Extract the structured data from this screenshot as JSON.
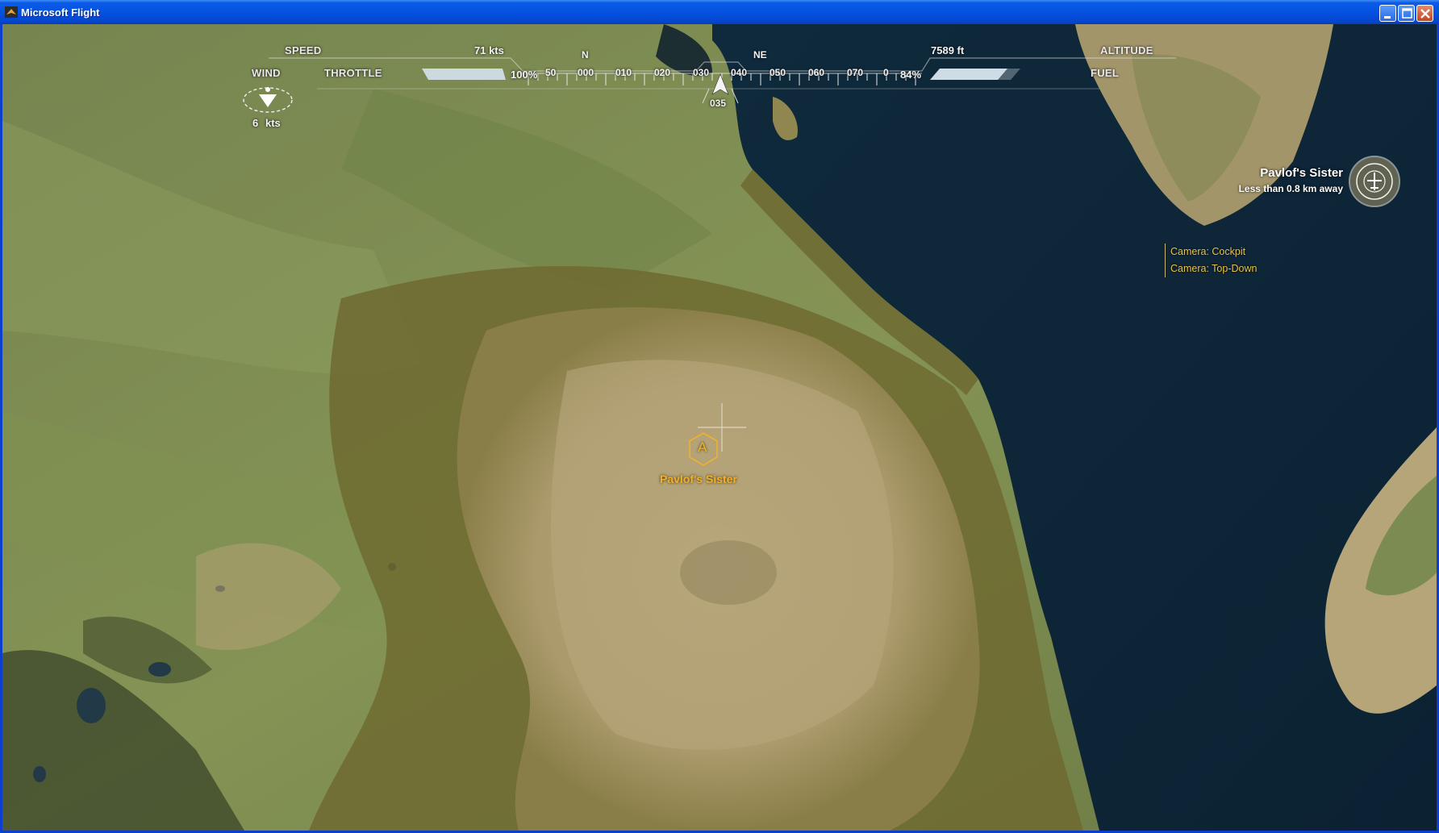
{
  "window": {
    "title": "Microsoft Flight",
    "icon": "airplane-app-icon",
    "buttons": [
      "minimize-icon",
      "maximize-icon",
      "close-icon"
    ]
  },
  "hud": {
    "speed_label": "SPEED",
    "speed_value": "71 kts",
    "wind_label": "WIND",
    "wind_value": "6",
    "wind_unit": "kts",
    "throttle_label": "THROTTLE",
    "throttle_value": "100%",
    "throttle_fraction": 1.0,
    "altitude_label": "ALTITUDE",
    "altitude_value": "7589 ft",
    "fuel_label": "FUEL",
    "fuel_value": "84%",
    "fuel_fraction": 0.84,
    "compass": {
      "cardinals": [
        "N",
        "NE"
      ],
      "ticks": [
        "50",
        "000",
        "010",
        "020",
        "030",
        "040",
        "050",
        "060",
        "070",
        "0"
      ],
      "heading": "035"
    }
  },
  "waypoint": {
    "marker_letter": "A",
    "name": "Pavlof's Sister"
  },
  "target": {
    "name": "Pavlof's Sister",
    "distance": "Less than 0.8 km away",
    "icon": "airplane-target-icon"
  },
  "camera_menu": {
    "items": [
      "Camera: Cockpit",
      "Camera: Top-Down"
    ]
  },
  "colors": {
    "accent": "#f0b030",
    "hud_text": "#f0f0f0",
    "water": "#0f2638",
    "titlebar": "#0552e0"
  }
}
